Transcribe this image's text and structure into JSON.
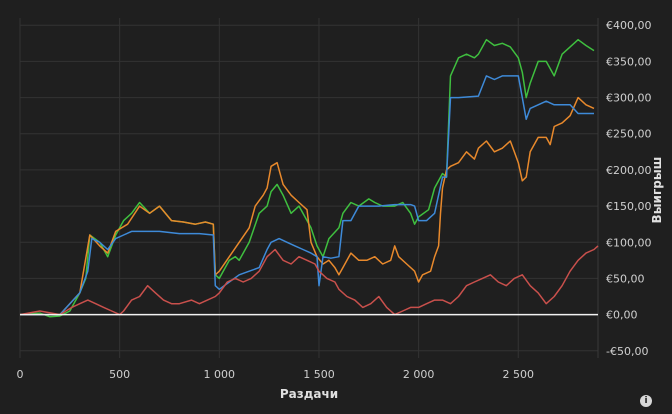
{
  "chart_data": {
    "type": "line",
    "xlabel": "Раздачи",
    "ylabel": "Выигрыш",
    "xlim": [
      0,
      2900
    ],
    "ylim": [
      -60,
      410
    ],
    "x_ticks": [
      0,
      500,
      1000,
      1500,
      2000,
      2500
    ],
    "x_tick_labels": [
      "0",
      "500",
      "1 000",
      "1 500",
      "2 000",
      "2 500"
    ],
    "y_ticks": [
      -50,
      0,
      50,
      100,
      150,
      200,
      250,
      300,
      350,
      400
    ],
    "y_tick_labels": [
      "-€50,00",
      "€0,00",
      "€50,00",
      "€100,00",
      "€150,00",
      "€200,00",
      "€250,00",
      "€300,00",
      "€350,00",
      "€400,00"
    ],
    "grid": true,
    "y_axis_position": "right",
    "zero_line": true,
    "series": [
      {
        "color": "#3fbf3f",
        "points": [
          [
            0,
            0
          ],
          [
            100,
            2
          ],
          [
            150,
            -3
          ],
          [
            200,
            -2
          ],
          [
            250,
            5
          ],
          [
            300,
            30
          ],
          [
            330,
            50
          ],
          [
            350,
            110
          ],
          [
            400,
            100
          ],
          [
            440,
            80
          ],
          [
            480,
            110
          ],
          [
            520,
            130
          ],
          [
            560,
            140
          ],
          [
            600,
            155
          ],
          [
            650,
            140
          ],
          [
            700,
            150
          ],
          [
            760,
            130
          ],
          [
            820,
            128
          ],
          [
            880,
            125
          ],
          [
            930,
            128
          ],
          [
            970,
            125
          ],
          [
            980,
            55
          ],
          [
            1000,
            50
          ],
          [
            1050,
            75
          ],
          [
            1080,
            80
          ],
          [
            1100,
            75
          ],
          [
            1150,
            100
          ],
          [
            1200,
            140
          ],
          [
            1240,
            150
          ],
          [
            1260,
            170
          ],
          [
            1290,
            180
          ],
          [
            1320,
            165
          ],
          [
            1360,
            140
          ],
          [
            1400,
            150
          ],
          [
            1460,
            120
          ],
          [
            1490,
            95
          ],
          [
            1520,
            80
          ],
          [
            1550,
            105
          ],
          [
            1600,
            120
          ],
          [
            1620,
            140
          ],
          [
            1660,
            155
          ],
          [
            1700,
            150
          ],
          [
            1750,
            160
          ],
          [
            1780,
            155
          ],
          [
            1820,
            150
          ],
          [
            1880,
            150
          ],
          [
            1920,
            155
          ],
          [
            1960,
            140
          ],
          [
            1980,
            125
          ],
          [
            2000,
            135
          ],
          [
            2050,
            145
          ],
          [
            2080,
            175
          ],
          [
            2120,
            195
          ],
          [
            2140,
            190
          ],
          [
            2160,
            330
          ],
          [
            2200,
            355
          ],
          [
            2240,
            360
          ],
          [
            2280,
            355
          ],
          [
            2300,
            360
          ],
          [
            2340,
            380
          ],
          [
            2380,
            372
          ],
          [
            2420,
            375
          ],
          [
            2460,
            370
          ],
          [
            2500,
            355
          ],
          [
            2520,
            335
          ],
          [
            2540,
            300
          ],
          [
            2560,
            320
          ],
          [
            2600,
            350
          ],
          [
            2640,
            350
          ],
          [
            2680,
            330
          ],
          [
            2720,
            360
          ],
          [
            2760,
            370
          ],
          [
            2800,
            380
          ],
          [
            2840,
            372
          ],
          [
            2880,
            365
          ]
        ]
      },
      {
        "color": "#e8892c",
        "points": [
          [
            0,
            0
          ],
          [
            200,
            0
          ],
          [
            300,
            30
          ],
          [
            350,
            110
          ],
          [
            400,
            95
          ],
          [
            440,
            85
          ],
          [
            480,
            115
          ],
          [
            540,
            125
          ],
          [
            600,
            150
          ],
          [
            650,
            140
          ],
          [
            700,
            150
          ],
          [
            760,
            130
          ],
          [
            820,
            128
          ],
          [
            880,
            125
          ],
          [
            930,
            128
          ],
          [
            970,
            125
          ],
          [
            980,
            55
          ],
          [
            1000,
            60
          ],
          [
            1050,
            80
          ],
          [
            1100,
            100
          ],
          [
            1150,
            120
          ],
          [
            1180,
            150
          ],
          [
            1220,
            165
          ],
          [
            1240,
            175
          ],
          [
            1260,
            205
          ],
          [
            1290,
            210
          ],
          [
            1320,
            180
          ],
          [
            1360,
            165
          ],
          [
            1400,
            155
          ],
          [
            1440,
            145
          ],
          [
            1460,
            100
          ],
          [
            1490,
            80
          ],
          [
            1520,
            70
          ],
          [
            1550,
            75
          ],
          [
            1580,
            65
          ],
          [
            1600,
            55
          ],
          [
            1620,
            65
          ],
          [
            1660,
            85
          ],
          [
            1700,
            75
          ],
          [
            1740,
            75
          ],
          [
            1780,
            80
          ],
          [
            1820,
            70
          ],
          [
            1860,
            75
          ],
          [
            1880,
            95
          ],
          [
            1900,
            80
          ],
          [
            1940,
            70
          ],
          [
            1980,
            60
          ],
          [
            2000,
            45
          ],
          [
            2020,
            55
          ],
          [
            2060,
            60
          ],
          [
            2080,
            80
          ],
          [
            2100,
            95
          ],
          [
            2110,
            140
          ],
          [
            2120,
            175
          ],
          [
            2140,
            200
          ],
          [
            2160,
            205
          ],
          [
            2200,
            210
          ],
          [
            2240,
            225
          ],
          [
            2280,
            215
          ],
          [
            2300,
            230
          ],
          [
            2340,
            240
          ],
          [
            2380,
            225
          ],
          [
            2420,
            230
          ],
          [
            2460,
            240
          ],
          [
            2480,
            225
          ],
          [
            2500,
            210
          ],
          [
            2520,
            185
          ],
          [
            2540,
            190
          ],
          [
            2560,
            225
          ],
          [
            2600,
            245
          ],
          [
            2640,
            245
          ],
          [
            2660,
            235
          ],
          [
            2680,
            260
          ],
          [
            2720,
            265
          ],
          [
            2760,
            275
          ],
          [
            2800,
            300
          ],
          [
            2840,
            290
          ],
          [
            2880,
            285
          ]
        ]
      },
      {
        "color": "#3e8ad8",
        "points": [
          [
            0,
            0
          ],
          [
            200,
            0
          ],
          [
            300,
            30
          ],
          [
            340,
            60
          ],
          [
            360,
            105
          ],
          [
            400,
            100
          ],
          [
            440,
            90
          ],
          [
            480,
            105
          ],
          [
            520,
            110
          ],
          [
            560,
            115
          ],
          [
            600,
            115
          ],
          [
            700,
            115
          ],
          [
            800,
            112
          ],
          [
            900,
            112
          ],
          [
            970,
            110
          ],
          [
            980,
            40
          ],
          [
            1000,
            35
          ],
          [
            1050,
            45
          ],
          [
            1100,
            55
          ],
          [
            1150,
            60
          ],
          [
            1200,
            65
          ],
          [
            1240,
            90
          ],
          [
            1260,
            100
          ],
          [
            1300,
            105
          ],
          [
            1340,
            100
          ],
          [
            1380,
            95
          ],
          [
            1420,
            90
          ],
          [
            1460,
            85
          ],
          [
            1490,
            80
          ],
          [
            1500,
            40
          ],
          [
            1520,
            80
          ],
          [
            1560,
            78
          ],
          [
            1600,
            80
          ],
          [
            1620,
            130
          ],
          [
            1660,
            130
          ],
          [
            1700,
            150
          ],
          [
            1800,
            150
          ],
          [
            1880,
            152
          ],
          [
            1960,
            152
          ],
          [
            1980,
            150
          ],
          [
            2000,
            130
          ],
          [
            2040,
            130
          ],
          [
            2080,
            140
          ],
          [
            2120,
            190
          ],
          [
            2140,
            190
          ],
          [
            2160,
            300
          ],
          [
            2200,
            300
          ],
          [
            2300,
            302
          ],
          [
            2340,
            330
          ],
          [
            2380,
            325
          ],
          [
            2420,
            330
          ],
          [
            2480,
            330
          ],
          [
            2500,
            330
          ],
          [
            2520,
            300
          ],
          [
            2540,
            270
          ],
          [
            2560,
            285
          ],
          [
            2600,
            290
          ],
          [
            2640,
            295
          ],
          [
            2680,
            290
          ],
          [
            2720,
            290
          ],
          [
            2760,
            290
          ],
          [
            2800,
            278
          ],
          [
            2880,
            278
          ]
        ]
      },
      {
        "color": "#c9504c",
        "points": [
          [
            0,
            0
          ],
          [
            100,
            5
          ],
          [
            200,
            0
          ],
          [
            260,
            10
          ],
          [
            300,
            15
          ],
          [
            340,
            20
          ],
          [
            380,
            15
          ],
          [
            420,
            10
          ],
          [
            460,
            5
          ],
          [
            500,
            0
          ],
          [
            520,
            5
          ],
          [
            560,
            20
          ],
          [
            600,
            25
          ],
          [
            640,
            40
          ],
          [
            680,
            30
          ],
          [
            720,
            20
          ],
          [
            760,
            15
          ],
          [
            800,
            15
          ],
          [
            860,
            20
          ],
          [
            900,
            15
          ],
          [
            940,
            20
          ],
          [
            980,
            25
          ],
          [
            1000,
            30
          ],
          [
            1040,
            45
          ],
          [
            1080,
            50
          ],
          [
            1120,
            45
          ],
          [
            1160,
            50
          ],
          [
            1200,
            60
          ],
          [
            1240,
            80
          ],
          [
            1280,
            90
          ],
          [
            1320,
            75
          ],
          [
            1360,
            70
          ],
          [
            1400,
            80
          ],
          [
            1440,
            75
          ],
          [
            1480,
            70
          ],
          [
            1500,
            60
          ],
          [
            1540,
            50
          ],
          [
            1580,
            45
          ],
          [
            1600,
            35
          ],
          [
            1640,
            25
          ],
          [
            1680,
            20
          ],
          [
            1720,
            10
          ],
          [
            1760,
            15
          ],
          [
            1800,
            25
          ],
          [
            1840,
            10
          ],
          [
            1880,
            0
          ],
          [
            1920,
            5
          ],
          [
            1960,
            10
          ],
          [
            2000,
            10
          ],
          [
            2040,
            15
          ],
          [
            2080,
            20
          ],
          [
            2120,
            20
          ],
          [
            2160,
            15
          ],
          [
            2200,
            25
          ],
          [
            2240,
            40
          ],
          [
            2280,
            45
          ],
          [
            2320,
            50
          ],
          [
            2360,
            55
          ],
          [
            2400,
            45
          ],
          [
            2440,
            40
          ],
          [
            2480,
            50
          ],
          [
            2520,
            55
          ],
          [
            2560,
            40
          ],
          [
            2600,
            30
          ],
          [
            2640,
            15
          ],
          [
            2680,
            25
          ],
          [
            2720,
            40
          ],
          [
            2760,
            60
          ],
          [
            2800,
            75
          ],
          [
            2840,
            85
          ],
          [
            2880,
            90
          ],
          [
            2900,
            95
          ]
        ]
      }
    ]
  },
  "info_icon": "info-icon"
}
